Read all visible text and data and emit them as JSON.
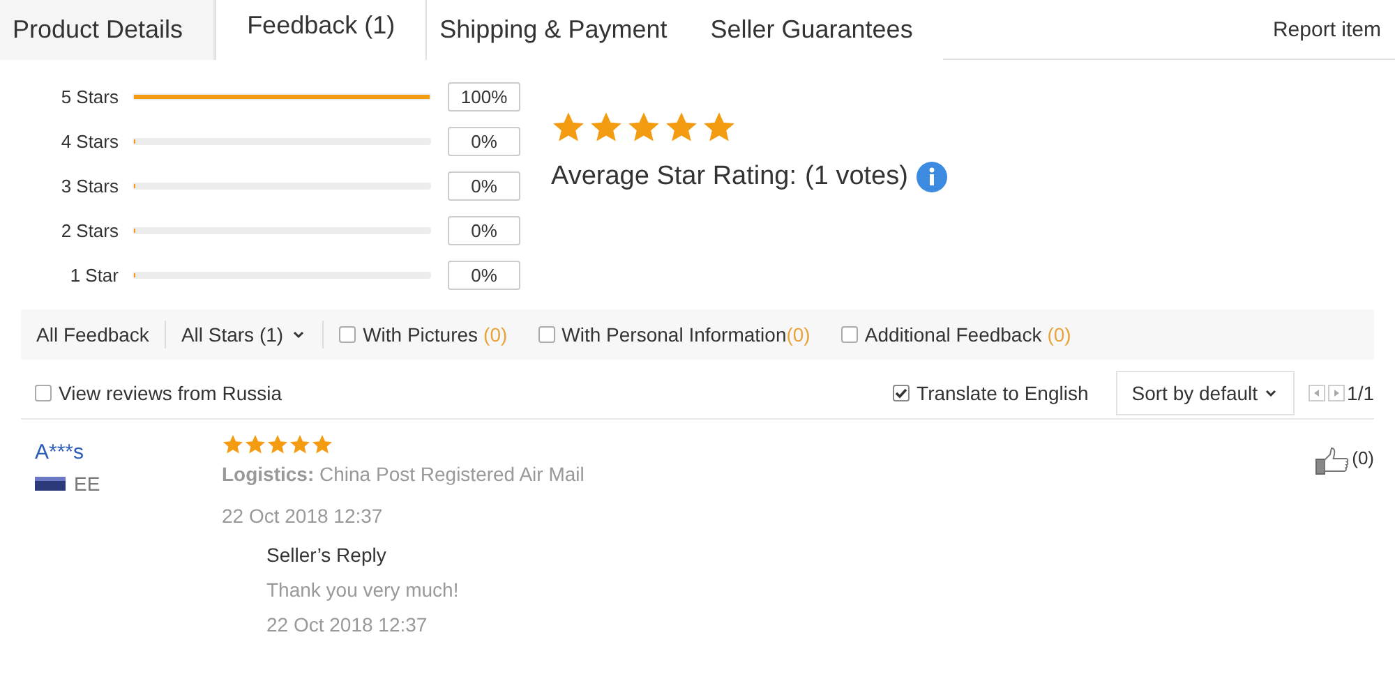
{
  "tabs": [
    {
      "label": "Product Details",
      "selected": false
    },
    {
      "label": "Feedback (1)",
      "selected": true
    },
    {
      "label": "Shipping & Payment",
      "selected": false
    },
    {
      "label": "Seller Guarantees",
      "selected": false
    }
  ],
  "report_link": "Report item",
  "distribution": [
    {
      "label": "5 Stars",
      "level": 1,
      "percent": "100%"
    },
    {
      "label": "4 Stars",
      "level": 0,
      "percent": "0%"
    },
    {
      "label": "3 Stars",
      "level": 0,
      "percent": "0%"
    },
    {
      "label": "2 Stars",
      "level": 0,
      "percent": "0%"
    },
    {
      "label": "1 Star",
      "level": 0,
      "percent": "0%"
    }
  ],
  "summary": {
    "stars": 5,
    "label": "Average Star Rating:",
    "votes": "(1 votes)"
  },
  "filters": {
    "all_feedback": "All Feedback",
    "stars_dropdown": "All Stars (1)",
    "checkboxes": [
      {
        "label": "With Pictures",
        "count": "(0)",
        "checked": false
      },
      {
        "label": "With Personal Information",
        "count": "(0)",
        "checked": false
      },
      {
        "label": "Additional Feedback",
        "count": "(0)",
        "checked": false
      }
    ]
  },
  "options": {
    "local_reviews": {
      "label": "View reviews from Russia",
      "checked": false
    },
    "translate": {
      "label": "Translate to English",
      "checked": true
    },
    "sort": "Sort by default",
    "page": "1/1"
  },
  "reviews": [
    {
      "name": "A***s",
      "country": "EE",
      "stars": 5,
      "logistics_label": "Logistics:",
      "logistics": "China Post Registered Air Mail",
      "date": "22 Oct 2018 12:37",
      "likes": "(0)",
      "reply": {
        "title": "Seller’s Reply",
        "text": "Thank you very much!",
        "date": "22 Oct 2018 12:37"
      }
    }
  ]
}
